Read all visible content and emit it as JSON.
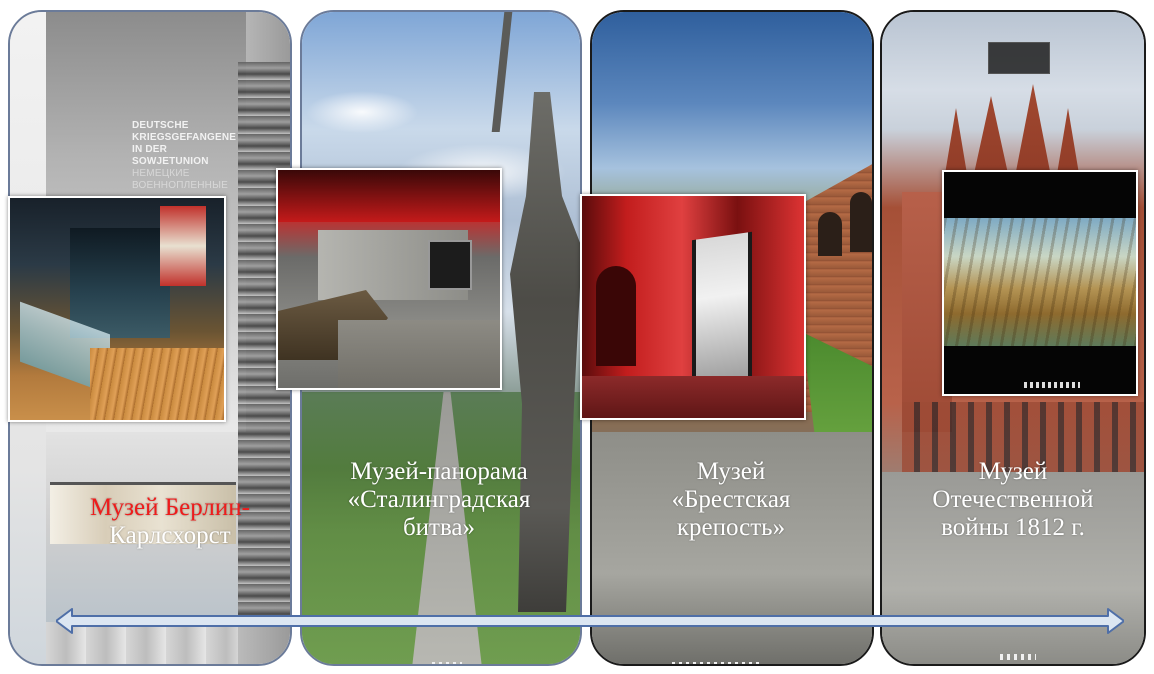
{
  "slide": {
    "panels": [
      {
        "id": "berlin",
        "caption_line1": "Музей Берлин-",
        "caption_line2": "Карлсхорст",
        "caption_line1_color": "#ee1c1c",
        "caption_line2_color": "#ffffff",
        "wall_text": "DEUTSCHE KRIEGSGEFANGENE IN DER SOWJETUNION",
        "wall_text_sub": "НЕМЕЦКИЕ ВОЕННОПЛЕННЫЕ"
      },
      {
        "id": "stalingrad",
        "caption_lines": [
          "Музей-панорама",
          "«Сталинградская",
          "битва»"
        ]
      },
      {
        "id": "brest",
        "caption_lines": [
          "Музей",
          "«Брестская",
          "крепость»"
        ]
      },
      {
        "id": "1812",
        "caption_lines": [
          "Музей",
          "Отечественной",
          "войны 1812 г."
        ]
      }
    ],
    "timeline_arrow": {
      "fill": "#dce6f2",
      "stroke": "#4f6fa8",
      "icon": "double-headed-arrow-icon"
    },
    "colors": {
      "panel_border_light": "#6b7b99",
      "panel_border_dark": "#1a1a1a",
      "caption_text": "#ffffff"
    }
  }
}
